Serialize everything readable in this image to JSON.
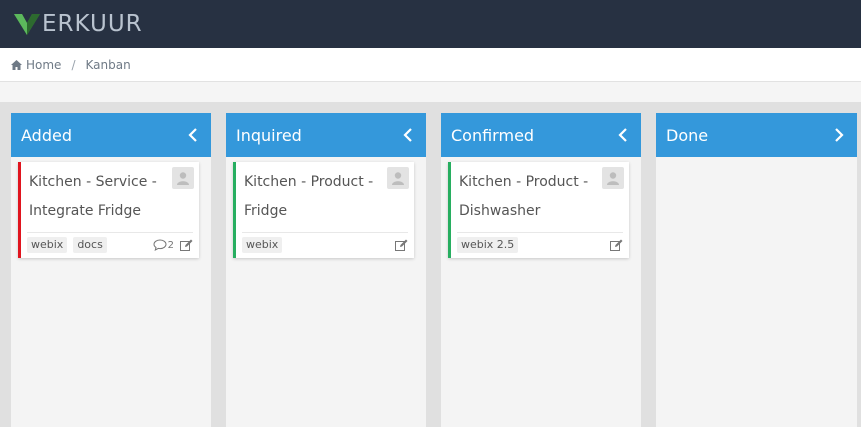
{
  "app": {
    "logo_text": "ERKUUR",
    "brand_colors": {
      "dark": "#2d6a2f",
      "light": "#5cb85c"
    }
  },
  "breadcrumb": {
    "home": "Home",
    "current": "Kanban"
  },
  "columns": [
    {
      "title": "Added",
      "toggle": "chevron-left-icon",
      "cards": [
        {
          "text": "Kitchen - Service - Integrate Fridge",
          "status_color": "#e0141e",
          "tags": [
            "webix",
            "docs"
          ],
          "comments": "2"
        }
      ]
    },
    {
      "title": "Inquired",
      "toggle": "chevron-left-icon",
      "cards": [
        {
          "text": "Kitchen - Product - Fridge",
          "status_color": "#27ae60",
          "tags": [
            "webix"
          ]
        }
      ]
    },
    {
      "title": "Confirmed",
      "toggle": "chevron-left-icon",
      "cards": [
        {
          "text": "Kitchen - Product - Dishwasher",
          "status_color": "#27ae60",
          "tags": [
            "webix 2.5"
          ]
        }
      ]
    },
    {
      "title": "Done",
      "toggle": "chevron-right-icon",
      "cards": []
    }
  ],
  "colors": {
    "topbar": "#273142",
    "column_header": "#3498db",
    "column_body": "#f4f4f4"
  }
}
